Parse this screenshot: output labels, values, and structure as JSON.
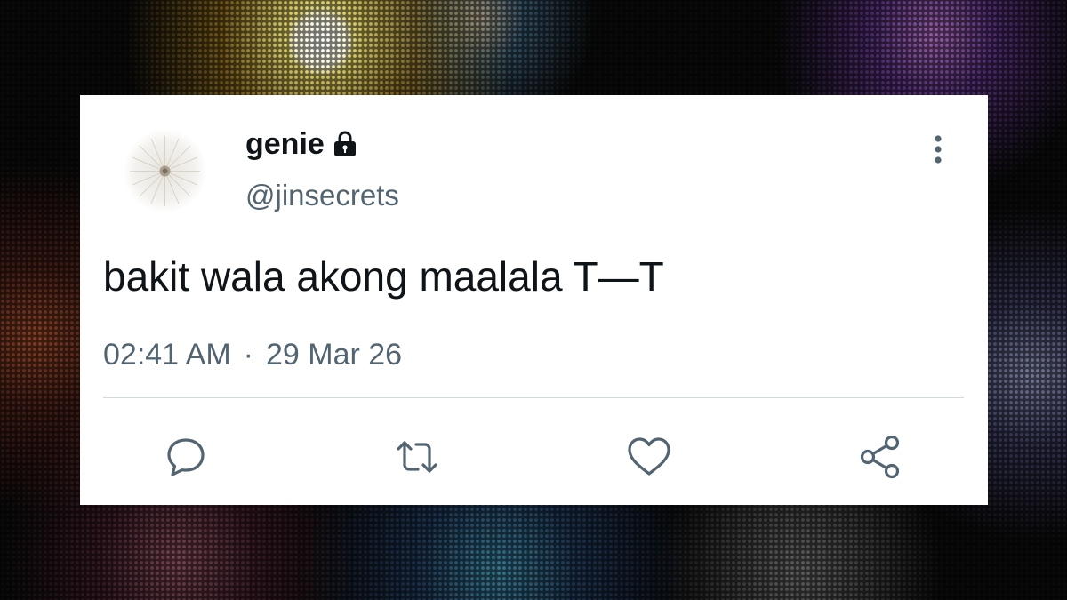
{
  "tweet": {
    "display_name": "genie",
    "handle": "@jinsecrets",
    "text": "bakit wala akong maalala T—T",
    "time": "02:41 AM",
    "separator": "·",
    "date": "29 Mar 26"
  },
  "icons": {
    "avatar": "dandelion-avatar",
    "lock": "lock-icon",
    "more": "more-options-icon",
    "reply": "reply-icon",
    "retweet": "retweet-icon",
    "like": "like-icon",
    "share": "share-icon"
  },
  "colors": {
    "card": "#ffffff",
    "text_primary": "#0f1419",
    "text_secondary": "#536471",
    "divider": "#cfd9de"
  }
}
